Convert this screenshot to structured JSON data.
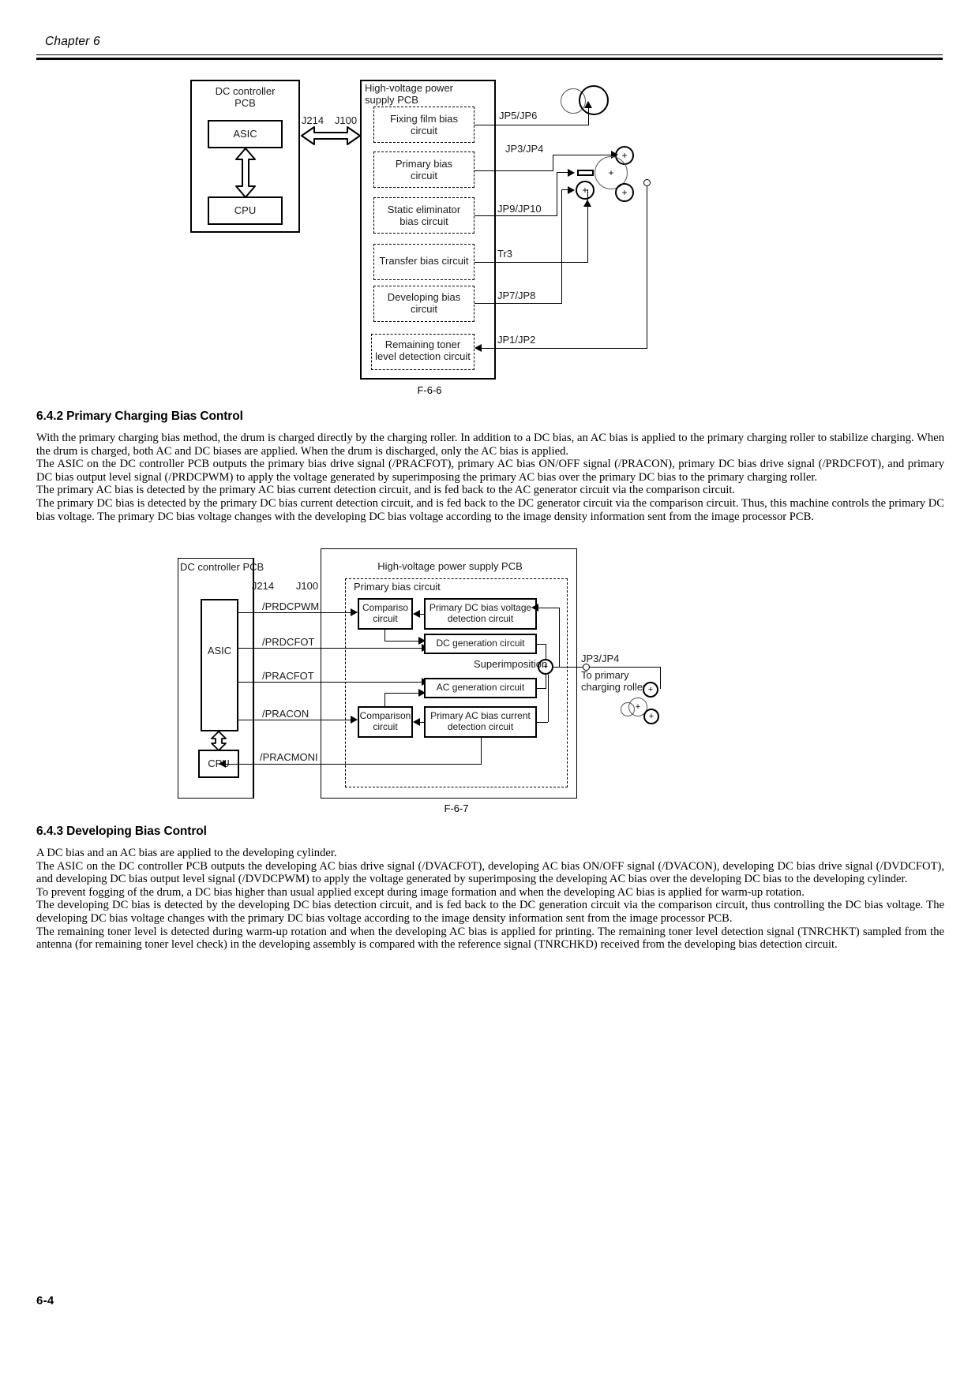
{
  "header": {
    "chapter": "Chapter 6"
  },
  "footer": {
    "page_number": "6-4"
  },
  "figure_6_6": {
    "caption": "F-6-6",
    "dc_controller": {
      "title": "DC controller\nPCB",
      "asic": "ASIC",
      "cpu": "CPU"
    },
    "connectors": {
      "j214": "J214",
      "j100": "J100"
    },
    "hvps": {
      "title": "High-voltage power\nsupply PCB",
      "circuits": [
        {
          "label": "Fixing film bias\ncircuit",
          "connector": "JP5/JP6"
        },
        {
          "label": "Primary bias\ncircuit",
          "connector": "JP3/JP4"
        },
        {
          "label": "Static eliminator\nbias circuit",
          "connector": "JP9/JP10"
        },
        {
          "label": "Transfer bias circuit",
          "connector": "Tr3"
        },
        {
          "label": "Developing bias\ncircuit",
          "connector": "JP7/JP8"
        },
        {
          "label": "Remaining toner\nlevel detection circuit",
          "connector": "JP1/JP2"
        }
      ]
    },
    "symbols": {
      "plus": "+",
      "minus": "–"
    }
  },
  "section_642": {
    "heading": "6.4.2 Primary Charging Bias Control",
    "paragraphs": [
      "With the primary charging bias method, the drum is charged directly by the charging roller. In addition to a DC bias, an AC bias is applied to the primary charging roller to stabilize charging. When the drum is charged, both AC and DC biases are applied. When the drum is discharged, only the AC bias is applied.",
      "The ASIC on the DC controller PCB outputs the primary bias drive signal (/PRACFOT), primary AC bias ON/OFF signal (/PRACON), primary DC bias drive signal (/PRDCFOT), and primary DC bias output level signal (/PRDCPWM) to apply the voltage generated by superimposing the primary AC bias over the primary DC bias to the primary charging roller.",
      "The primary AC bias is detected by the primary AC bias current detection circuit, and is fed back to the AC generator circuit via the comparison circuit.",
      "The primary DC bias is detected by the primary DC bias current detection circuit, and is fed back to the DC generator circuit via the comparison circuit. Thus, this machine controls the primary DC bias voltage. The primary DC bias voltage changes with the developing DC bias voltage according to the image density information sent from the image processor PCB."
    ]
  },
  "figure_6_7": {
    "caption": "F-6-7",
    "dc_controller_title": "DC controller PCB",
    "hvps_title": "High-voltage power supply PCB",
    "primary_bias_circuit_title": "Primary bias circuit",
    "asic": "ASIC",
    "cpu": "CPU",
    "connectors": {
      "j214": "J214",
      "j100": "J100"
    },
    "signals": [
      "/PRDCPWM",
      "/PRDCFOT",
      "/PRACFOT",
      "/PRACON",
      "/PRACMONI"
    ],
    "blocks": [
      "Compariso\ncircuit",
      "Primary DC bias voltage\ndetection circuit",
      "DC generation circuit",
      "AC generation circuit",
      "Comparison\ncircuit",
      "Primary AC bias current\ndetection circuit"
    ],
    "superimposition_label": "Superimposition",
    "output_connector": "JP3/JP4",
    "output_note": "To primary\ncharging roller",
    "symbols": {
      "plus": "+"
    }
  },
  "section_643": {
    "heading": "6.4.3 Developing Bias Control",
    "paragraphs": [
      "A DC bias and an AC bias are applied to the developing cylinder.",
      "The ASIC on the DC controller PCB outputs the developing AC bias drive signal (/DVACFOT), developing AC bias ON/OFF signal (/DVACON), developing DC bias drive signal (/DVDCFOT), and developing DC bias output level signal (/DVDCPWM) to apply the voltage generated by superimposing the developing AC bias over the developing DC bias to the developing cylinder.",
      "To prevent fogging of the drum, a DC bias higher than usual applied except during image formation and when the developing AC bias is applied for warm-up rotation.",
      "The developing DC bias is detected by the developing DC bias detection circuit, and is fed back to the DC generation circuit via the comparison circuit, thus controlling the DC bias voltage. The developing DC bias voltage changes with the primary DC bias voltage according to the image density information sent from the image processor PCB.",
      "The remaining toner level is detected during warm-up rotation and when the developing AC bias is applied for printing. The remaining toner level detection signal (TNRCHKT) sampled from the antenna (for remaining toner level check) in the developing assembly is compared with the reference signal (TNRCHKD) received from the developing bias detection circuit."
    ]
  }
}
